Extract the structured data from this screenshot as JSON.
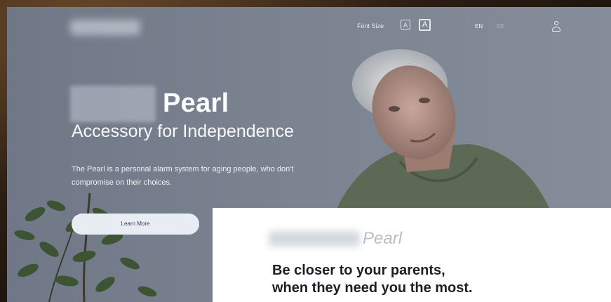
{
  "nav": {
    "font_size_label": "Font Size",
    "font_small_glyph": "A",
    "font_large_glyph": "A",
    "lang_en": "EN",
    "lang_de": "DE",
    "user_icon": "user-icon"
  },
  "hero": {
    "title": "Pearl",
    "subtitle": "Accessory for Independence",
    "description": "The Pearl is a personal alarm system for aging people, who don't compromise on their choices.",
    "cta_label": "Learn More"
  },
  "card": {
    "brand": "Pearl",
    "headline_line1": "Be closer to your parents,",
    "headline_line2": "when they need you the most."
  },
  "colors": {
    "hero_bg": "#7b8391",
    "cta_bg": "#e8ecf3",
    "card_bg": "#ffffff",
    "headline": "#1d2026"
  }
}
